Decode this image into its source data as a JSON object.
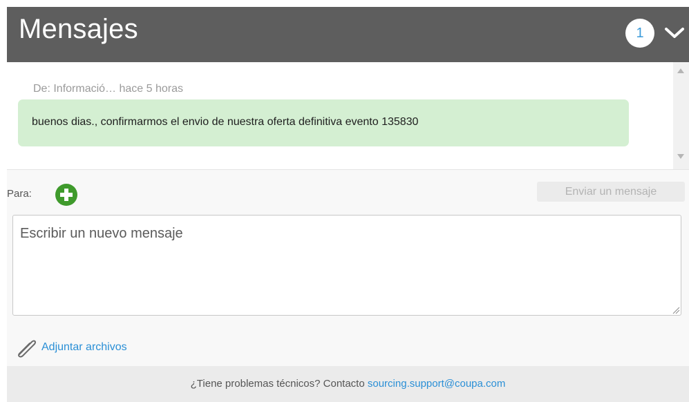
{
  "header": {
    "title": "Mensajes",
    "unread_count": "1",
    "collapse_icon": "chevron-down-icon"
  },
  "messages": [
    {
      "meta": "De: Informació… hace 5 horas",
      "text": "buenos dias., confirmarmos el envio de nuestra oferta definitiva evento 135830"
    }
  ],
  "compose": {
    "to_label": "Para:",
    "add_recipient_icon": "plus-circle-icon",
    "send_label": "Enviar un mensaje",
    "placeholder": "Escribir un nuevo mensaje",
    "attach_label": "Adjuntar archivos",
    "attach_icon": "paperclip-icon"
  },
  "footer": {
    "text": "¿Tiene problemas técnicos? Contacto",
    "email": "sourcing.support@coupa.com"
  },
  "colors": {
    "header_bg": "#5e5e5e",
    "bubble_bg": "#d4efd2",
    "add_green": "#3f9a2c",
    "link_blue": "#2a8fd6"
  }
}
